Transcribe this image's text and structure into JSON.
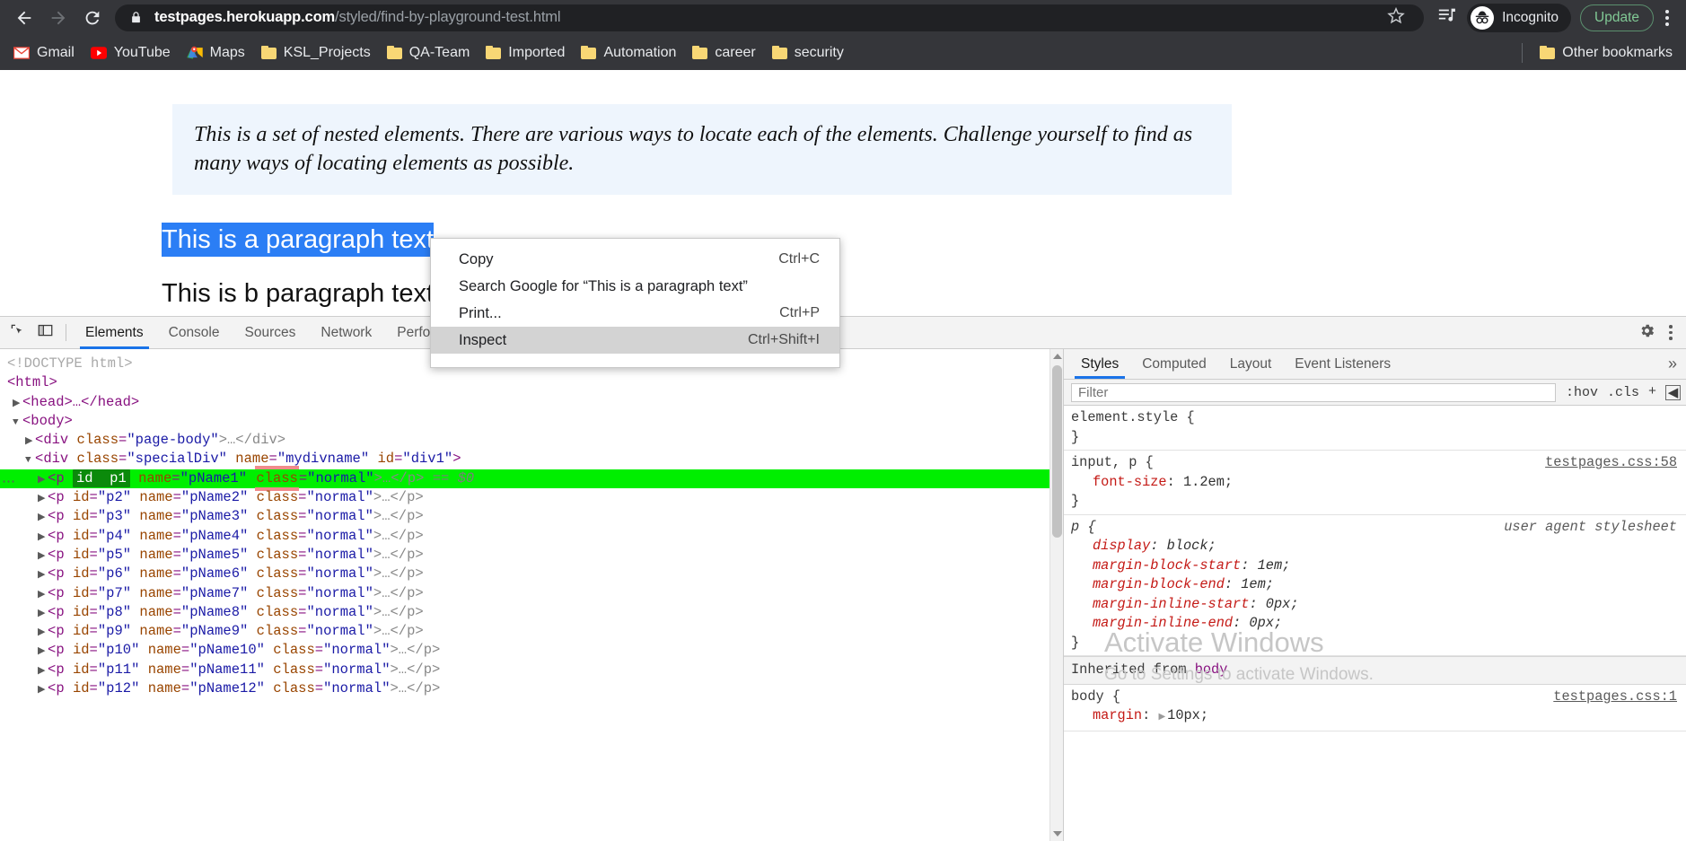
{
  "browser": {
    "back_icon": "back-arrow-icon",
    "forward_icon": "forward-arrow-icon",
    "reload_icon": "reload-icon",
    "lock_icon": "lock-icon",
    "url_host": "testpages.herokuapp.com",
    "url_path": "/styled/find-by-playground-test.html",
    "star_icon": "bookmark-star-icon",
    "media_icon": "media-control-icon",
    "incognito_label": "Incognito",
    "update_label": "Update",
    "menu_icon": "chrome-menu-icon"
  },
  "bookmarks": {
    "items": [
      {
        "label": "Gmail",
        "icon": "gmail-icon"
      },
      {
        "label": "YouTube",
        "icon": "youtube-icon"
      },
      {
        "label": "Maps",
        "icon": "maps-icon"
      },
      {
        "label": "KSL_Projects",
        "icon": "folder-icon"
      },
      {
        "label": "QA-Team",
        "icon": "folder-icon"
      },
      {
        "label": "Imported",
        "icon": "folder-icon"
      },
      {
        "label": "Automation",
        "icon": "folder-icon"
      },
      {
        "label": "career",
        "icon": "folder-icon"
      },
      {
        "label": "security",
        "icon": "folder-icon"
      }
    ],
    "other_label": "Other bookmarks",
    "other_icon": "folder-icon"
  },
  "page": {
    "info_text": "This is a set of nested elements. There are various ways to locate each of the elements. Challenge yourself to find as many ways of locating elements as possible.",
    "paragraph_a": "This is a paragraph text",
    "paragraph_b": "This is b paragraph text",
    "selection_color": "#2b7ef5",
    "info_box_color": "#eef5fd"
  },
  "context_menu": {
    "items": [
      {
        "label": "Copy",
        "accel": "Ctrl+C",
        "highlighted": false
      },
      {
        "label": "Search Google for “This is a paragraph text”",
        "accel": "",
        "highlighted": false
      },
      {
        "label": "Print...",
        "accel": "Ctrl+P",
        "highlighted": false
      },
      {
        "label": "Inspect",
        "accel": "Ctrl+Shift+I",
        "highlighted": true
      }
    ]
  },
  "devtools": {
    "inspect_icon": "inspect-element-icon",
    "device_icon": "device-toolbar-icon",
    "settings_icon": "gear-icon",
    "more_icon": "devtools-kebab-icon",
    "tabs": [
      {
        "label": "Elements",
        "active": true
      },
      {
        "label": "Console",
        "active": false
      },
      {
        "label": "Sources",
        "active": false
      },
      {
        "label": "Network",
        "active": false
      },
      {
        "label": "Perform",
        "active": false
      }
    ],
    "dom": {
      "doctype": "<!DOCTYPE html>",
      "html_open": "<html>",
      "head_line": "<head>…</head>",
      "body_open": "<body>",
      "page_body_div": {
        "tag": "div",
        "class_attr": "class",
        "class_value": "\"page-body\"",
        "tail": ">…</div>"
      },
      "special_div": {
        "tag": "div",
        "attrs": [
          {
            "name": "class",
            "value": "\"specialDiv\""
          },
          {
            "name": "name",
            "value": "\"mydivname\""
          },
          {
            "name": "id",
            "value": "\"div1\""
          }
        ],
        "tail": ">"
      },
      "selected_row": {
        "tag": "p",
        "edit_attr_name": "id",
        "edit_attr_value": "p1",
        "attrs": [
          {
            "name": "name",
            "value": "\"pName1\""
          },
          {
            "name": "class",
            "value": "\"normal\""
          }
        ],
        "tail": ">…</p>",
        "console_ref": "== $0"
      },
      "rows": [
        {
          "id": "\"p2\"",
          "name": "\"pName2\"",
          "class": "\"normal\""
        },
        {
          "id": "\"p3\"",
          "name": "\"pName3\"",
          "class": "\"normal\""
        },
        {
          "id": "\"p4\"",
          "name": "\"pName4\"",
          "class": "\"normal\""
        },
        {
          "id": "\"p5\"",
          "name": "\"pName5\"",
          "class": "\"normal\""
        },
        {
          "id": "\"p6\"",
          "name": "\"pName6\"",
          "class": "\"normal\""
        },
        {
          "id": "\"p7\"",
          "name": "\"pName7\"",
          "class": "\"normal\""
        },
        {
          "id": "\"p8\"",
          "name": "\"pName8\"",
          "class": "\"normal\""
        },
        {
          "id": "\"p9\"",
          "name": "\"pName9\"",
          "class": "\"normal\""
        },
        {
          "id": "\"p10\"",
          "name": "\"pName10\"",
          "class": "\"normal\""
        },
        {
          "id": "\"p11\"",
          "name": "\"pName11\"",
          "class": "\"normal\""
        },
        {
          "id": "\"p12\"",
          "name": "\"pName12\"",
          "class": "\"normal\""
        }
      ]
    },
    "styles": {
      "tabs": [
        {
          "label": "Styles",
          "active": true
        },
        {
          "label": "Computed",
          "active": false
        },
        {
          "label": "Layout",
          "active": false
        },
        {
          "label": "Event Listeners",
          "active": false
        }
      ],
      "overflow_label": "»",
      "filter_placeholder": "Filter",
      "hov_label": ":hov",
      "cls_label": ".cls",
      "plus_label": "+",
      "rules": [
        {
          "selector": "element.style {",
          "source": "",
          "props": [],
          "close": "}"
        },
        {
          "selector": "input, p {",
          "source": "testpages.css:58",
          "props": [
            {
              "name": "font-size",
              "value": "1.2em;"
            }
          ],
          "close": "}"
        },
        {
          "selector": "p {",
          "source": "user agent stylesheet",
          "ua": true,
          "props": [
            {
              "name": "display",
              "value": "block;"
            },
            {
              "name": "margin-block-start",
              "value": "1em;"
            },
            {
              "name": "margin-block-end",
              "value": "1em;"
            },
            {
              "name": "margin-inline-start",
              "value": "0px;"
            },
            {
              "name": "margin-inline-end",
              "value": "0px;"
            }
          ],
          "close": "}"
        }
      ],
      "inherited_label": "Inherited from",
      "inherited_tag": "body",
      "body_rule": {
        "selector": "body {",
        "source": "testpages.css:1",
        "props": [
          {
            "name": "margin",
            "value": "10px;"
          }
        ]
      }
    }
  },
  "watermark": {
    "title": "Activate Windows",
    "subtitle": "Go to Settings to activate Windows."
  }
}
